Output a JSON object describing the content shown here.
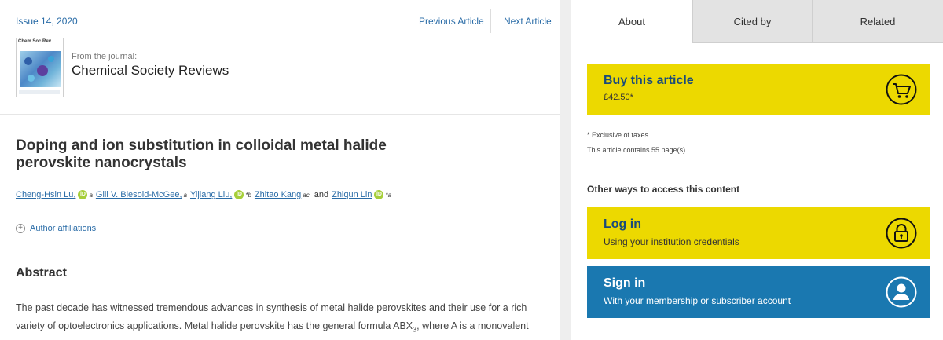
{
  "article_header": {
    "issue": "Issue 14, 2020",
    "prev_label": "Previous Article",
    "next_label": "Next Article",
    "cover_title": "Chem Soc Rev",
    "from_label": "From the journal:",
    "journal_name": "Chemical Society Reviews"
  },
  "article": {
    "title_line1": "Doping and ion substitution in colloidal metal halide",
    "title_line2": "perovskite nanocrystals",
    "authors": [
      {
        "name": "Cheng-Hsin Lu,",
        "sup": "a",
        "orcid": true
      },
      {
        "name": "Gill V. Biesold-McGee,",
        "sup": "a",
        "orcid": false
      },
      {
        "name": "Yijiang Liu,",
        "sup": "*b",
        "orcid": true
      },
      {
        "name": "Zhitao Kang",
        "sup": "ac",
        "orcid": false
      },
      {
        "name": "Zhiqun Lin",
        "sup": "*a",
        "orcid": true
      }
    ],
    "and_word": "and",
    "orcid_label": "iD",
    "affiliations_label": "Author affiliations",
    "abstract_heading": "Abstract",
    "abstract_line1": "The past decade has witnessed tremendous advances in synthesis of metal halide perovskites and their use for a rich",
    "abstract_line2_a": "variety of optoelectronics applications. Metal halide perovskite has the general formula ABX",
    "abstract_line2_sub": "3",
    "abstract_line2_b": ", where A is a monovalent"
  },
  "sidebar": {
    "tabs": [
      "About",
      "Cited by",
      "Related"
    ],
    "buy": {
      "title": "Buy this article",
      "price": "£42.50*"
    },
    "note_taxes": "* Exclusive of taxes",
    "note_pages": "This article contains 55 page(s)",
    "other_ways": "Other ways to access this content",
    "login": {
      "title": "Log in",
      "subtitle": "Using your institution credentials"
    },
    "signin": {
      "title": "Sign in",
      "subtitle": "With your membership or subscriber account"
    }
  },
  "colors": {
    "accent_yellow": "#ecd900",
    "accent_blue": "#1a78b0",
    "link": "#2a6ca7",
    "orcid_green": "#a6ce39"
  },
  "icons": [
    "cart-icon",
    "lock-icon",
    "user-icon",
    "orcid-icon",
    "plus-circle-icon"
  ]
}
